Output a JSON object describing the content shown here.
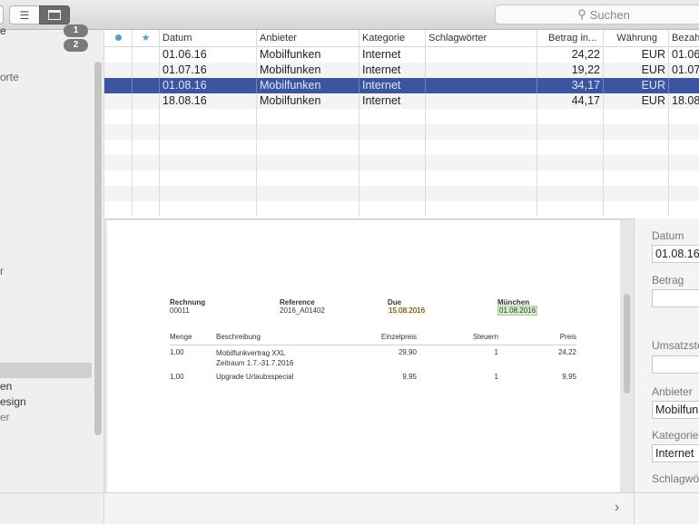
{
  "toolbar": {
    "search_placeholder": "Suchen"
  },
  "sidebar": {
    "items": [
      {
        "label": "e",
        "badge": "1"
      },
      {
        "label": "",
        "badge": "2"
      },
      {
        "label": "orte"
      },
      {
        "label": "r"
      },
      {
        "label": "en"
      },
      {
        "label": "esign"
      },
      {
        "label": "er"
      }
    ]
  },
  "table": {
    "columns": [
      "",
      "★",
      "Datum",
      "Anbieter",
      "Kategorie",
      "Schlagwörter",
      "Betrag in...",
      "Währung",
      "Bezahl"
    ],
    "rows": [
      {
        "datum": "01.06.16",
        "anbieter": "Mobilfunken",
        "kategorie": "Internet",
        "schlagwoerter": "",
        "betrag": "24,22",
        "waehrung": "EUR",
        "bezahlt": "01.06"
      },
      {
        "datum": "01.07.16",
        "anbieter": "Mobilfunken",
        "kategorie": "Internet",
        "schlagwoerter": "",
        "betrag": "19,22",
        "waehrung": "EUR",
        "bezahlt": "01.07"
      },
      {
        "datum": "01.08.16",
        "anbieter": "Mobilfunken",
        "kategorie": "Internet",
        "schlagwoerter": "",
        "betrag": "34,17",
        "waehrung": "EUR",
        "bezahlt": ""
      },
      {
        "datum": "18.08.16",
        "anbieter": "Mobilfunken",
        "kategorie": "Internet",
        "schlagwoerter": "",
        "betrag": "44,17",
        "waehrung": "EUR",
        "bezahlt": "18.08"
      }
    ]
  },
  "invoice": {
    "rechnung_label": "Rechnung",
    "rechnung": "00011",
    "reference_label": "Reference",
    "reference": "2016_A01402",
    "due_label": "Due",
    "due": "15.08.2016",
    "city": "München",
    "date": "01.08.2016",
    "headers": [
      "Menge",
      "Beschreibung",
      "Einzelpreis",
      "Steuern",
      "Preis"
    ],
    "lines": [
      {
        "menge": "1,00",
        "beschreibung": "Mobilfunkvertrag XXL",
        "beschreibung2": "Zeitraum 1.7.-31.7.2016",
        "einzelpreis": "29,90",
        "steuern": "1",
        "preis": "24,22"
      },
      {
        "menge": "1,00",
        "beschreibung": "Upgrade Urlaubsspecial",
        "beschreibung2": "",
        "einzelpreis": "9,95",
        "steuern": "1",
        "preis": "9,95"
      }
    ]
  },
  "inspector": {
    "datum_label": "Datum",
    "datum": "01.08.16",
    "betrag_label": "Betrag",
    "betrag": "",
    "umsatz_label": "Umsatzsteuer",
    "umsatz": "",
    "anbieter_label": "Anbieter",
    "anbieter": "Mobilfunken",
    "kategorie_label": "Kategorie",
    "kategorie": "Internet",
    "schlag_label": "Schlagwörter"
  },
  "colors": {
    "selection": "#3b55a0",
    "dot": "#5b9bc8"
  }
}
